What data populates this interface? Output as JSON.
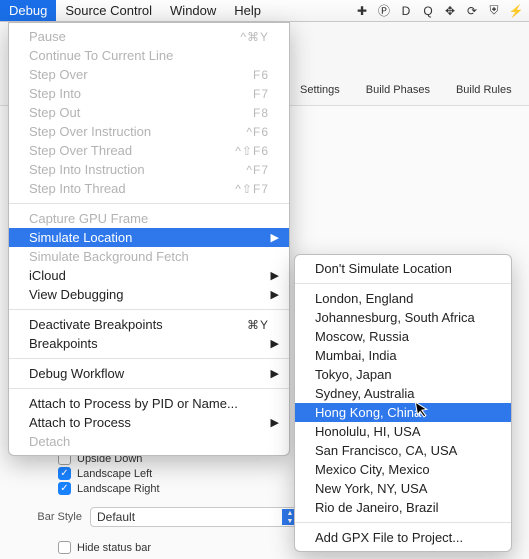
{
  "menubar": {
    "items": [
      "Debug",
      "Source Control",
      "Window",
      "Help"
    ],
    "active_index": 0
  },
  "status_icons": [
    "plus",
    "p-circle",
    "d-square",
    "q-square",
    "dropbox",
    "sync",
    "shield",
    "bolt"
  ],
  "dropdown": {
    "groups": [
      [
        {
          "label": "Pause",
          "shortcut": "^⌘Y",
          "disabled": true
        },
        {
          "label": "Continue To Current Line",
          "shortcut": "",
          "disabled": true
        },
        {
          "label": "Step Over",
          "shortcut": "F6",
          "disabled": true
        },
        {
          "label": "Step Into",
          "shortcut": "F7",
          "disabled": true
        },
        {
          "label": "Step Out",
          "shortcut": "F8",
          "disabled": true
        },
        {
          "label": "Step Over Instruction",
          "shortcut": "^F6",
          "disabled": true
        },
        {
          "label": "Step Over Thread",
          "shortcut": "^⇧F6",
          "disabled": true
        },
        {
          "label": "Step Into Instruction",
          "shortcut": "^F7",
          "disabled": true
        },
        {
          "label": "Step Into Thread",
          "shortcut": "^⇧F7",
          "disabled": true
        }
      ],
      [
        {
          "label": "Capture GPU Frame",
          "disabled": true
        },
        {
          "label": "Simulate Location",
          "submenu": true,
          "highlight": true
        },
        {
          "label": "Simulate Background Fetch",
          "disabled": true
        },
        {
          "label": "iCloud",
          "submenu": true
        },
        {
          "label": "View Debugging",
          "submenu": true
        }
      ],
      [
        {
          "label": "Deactivate Breakpoints",
          "shortcut": "⌘Y"
        },
        {
          "label": "Breakpoints",
          "submenu": true
        }
      ],
      [
        {
          "label": "Debug Workflow",
          "submenu": true
        }
      ],
      [
        {
          "label": "Attach to Process by PID or Name..."
        },
        {
          "label": "Attach to Process",
          "submenu": true
        },
        {
          "label": "Detach",
          "disabled": true
        }
      ]
    ]
  },
  "submenu": {
    "groups": [
      [
        {
          "label": "Don't Simulate Location"
        }
      ],
      [
        {
          "label": "London, England"
        },
        {
          "label": "Johannesburg, South Africa"
        },
        {
          "label": "Moscow, Russia"
        },
        {
          "label": "Mumbai, India"
        },
        {
          "label": "Tokyo, Japan"
        },
        {
          "label": "Sydney, Australia"
        },
        {
          "label": "Hong Kong, China",
          "highlight": true
        },
        {
          "label": "Honolulu, HI, USA"
        },
        {
          "label": "San Francisco, CA, USA"
        },
        {
          "label": "Mexico City, Mexico"
        },
        {
          "label": "New York, NY, USA"
        },
        {
          "label": "Rio de Janeiro, Brazil"
        }
      ],
      [
        {
          "label": "Add GPX File to Project..."
        }
      ]
    ]
  },
  "background": {
    "tabs": [
      "Settings",
      "Build Phases",
      "Build Rules"
    ],
    "orientation": [
      {
        "label": "Upside Down",
        "checked": false
      },
      {
        "label": "Landscape Left",
        "checked": true
      },
      {
        "label": "Landscape Right",
        "checked": true
      }
    ],
    "bar_style": {
      "label": "Bar Style",
      "value": "Default"
    },
    "hide_status": {
      "label": "Hide status bar",
      "checked": false
    }
  }
}
